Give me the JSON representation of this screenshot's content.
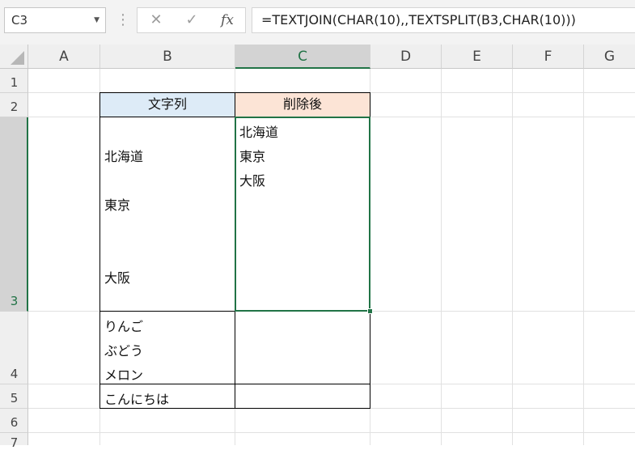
{
  "formula_bar": {
    "name_box": "C3",
    "cancel_icon": "✕",
    "enter_icon": "✓",
    "fx_label": "fx",
    "formula": "=TEXTJOIN(CHAR(10),,TEXTSPLIT(B3,CHAR(10)))"
  },
  "columns": [
    "A",
    "B",
    "C",
    "D",
    "E",
    "F",
    "G"
  ],
  "rows": [
    "1",
    "2",
    "3",
    "4",
    "5",
    "6",
    "7"
  ],
  "cells": {
    "B2": "文字列",
    "C2": "削除後",
    "B3": [
      "北海道",
      "東京",
      "大阪"
    ],
    "C3": [
      "北海道",
      "東京",
      "大阪"
    ],
    "B4": [
      "りんご",
      "ぶどう",
      "メロン"
    ],
    "B5": "こんにちは"
  },
  "colors": {
    "header_b": "#ddebf7",
    "header_c": "#fce4d6",
    "selection": "#217346"
  }
}
